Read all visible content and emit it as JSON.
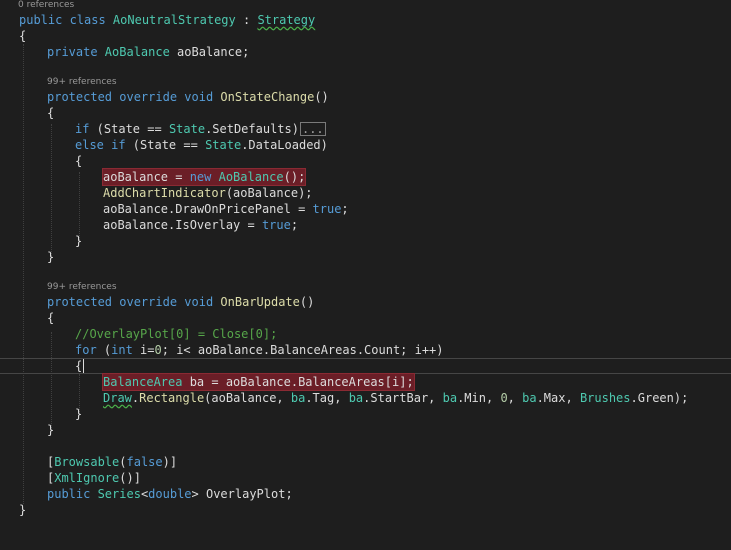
{
  "lens": {
    "class_refs": "0 references",
    "method1_refs": "99+ references",
    "method2_refs": "99+ references"
  },
  "code": {
    "l1": {
      "kw": "public class ",
      "type": "AoNeutralStrategy",
      "sep": " : ",
      "base": "Strategy"
    },
    "l2": "{",
    "l3": {
      "kw": "private ",
      "type": "AoBalance",
      "rest": " aoBalance;"
    },
    "l4": {
      "kw1": "protected ",
      "kw2": "override ",
      "kw3": "void ",
      "method": "OnStateChange",
      "rest": "()"
    },
    "l5": "{",
    "l6": {
      "kw": "if",
      "a": " (State == ",
      "type": "State",
      "b": ".SetDefaults)",
      "collapsed": "..."
    },
    "l7": {
      "kw1": "else ",
      "kw2": "if",
      "a": " (State == ",
      "type": "State",
      "b": ".DataLoaded)"
    },
    "l8": "{",
    "l9": {
      "a": "aoBalance = ",
      "kw": "new ",
      "type": "AoBalance",
      "b": "();"
    },
    "l10": {
      "method": "AddChartIndicator",
      "rest": "(aoBalance);"
    },
    "l11": {
      "a": "aoBalance.DrawOnPricePanel = ",
      "kw": "true",
      "b": ";"
    },
    "l12": {
      "a": "aoBalance.IsOverlay = ",
      "kw": "true",
      "b": ";"
    },
    "l13": "}",
    "l14": "}",
    "l15": {
      "kw1": "protected ",
      "kw2": "override ",
      "kw3": "void ",
      "method": "OnBarUpdate",
      "rest": "()"
    },
    "l16": "{",
    "l17": "//OverlayPlot[0] = Close[0];",
    "l18": {
      "kw": "for",
      "a": " (",
      "kw2": "int",
      "b": " i=",
      "n0": "0",
      "c": "; i< aoBalance.BalanceAreas.Count; i++)"
    },
    "l19": "{",
    "l20": {
      "type": "BalanceArea",
      "rest": " ba = aoBalance.BalanceAreas[i];"
    },
    "l21": {
      "type": "Draw",
      "a": ".",
      "method": "Rectangle",
      "b": "(aoBalance, ",
      "p1": "ba",
      "c": ".Tag, ",
      "p2": "ba",
      "d": ".StartBar, ",
      "p3": "ba",
      "e": ".Min, ",
      "n0": "0",
      "f": ", ",
      "p4": "ba",
      "g": ".Max, ",
      "type2": "Brushes",
      "h": ".Green);"
    },
    "l22": "}",
    "l23": "}",
    "l24": {
      "a": "[",
      "type": "Browsable",
      "b": "(",
      "kw": "false",
      "c": ")]"
    },
    "l25": {
      "a": "[",
      "type": "XmlIgnore",
      "b": "()]"
    },
    "l26": {
      "kw": "public ",
      "type": "Series",
      "a": "<",
      "kw2": "double",
      "b": "> OverlayPlot;"
    },
    "l27": "}"
  },
  "colors": {
    "background": "#1e1e1e",
    "keyword": "#569cd6",
    "type": "#4ec9b0",
    "method": "#dcdcaa",
    "comment": "#57a64a",
    "error_highlight": "#6b1e27"
  }
}
